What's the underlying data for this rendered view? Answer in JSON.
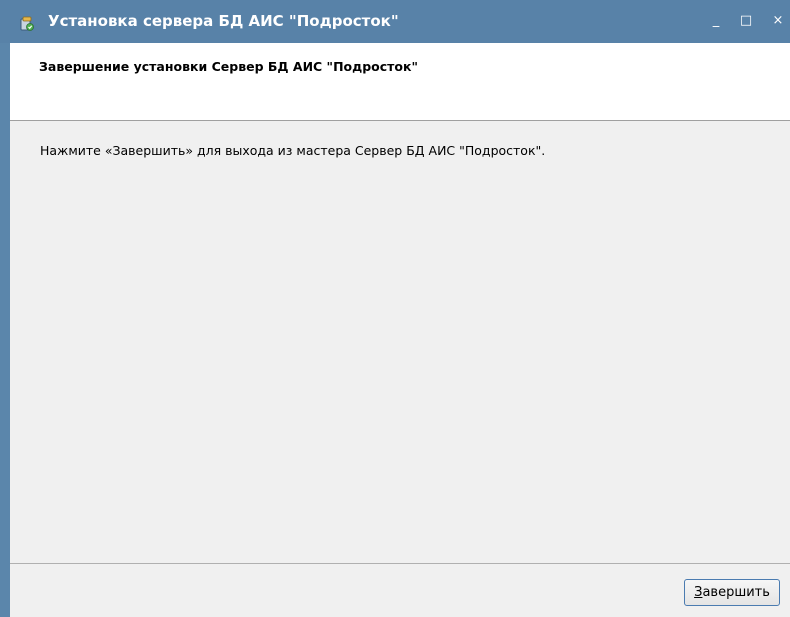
{
  "window": {
    "title": "Установка сервера БД АИС \"Подросток\"",
    "controls": {
      "minimize": "_",
      "maximize": "□",
      "close": "×"
    }
  },
  "header": {
    "title": "Завершение установки Сервер БД АИС \"Подросток\""
  },
  "body": {
    "message": "Нажмите «Завершить» для выхода из мастера Сервер БД АИС \"Подросток\"."
  },
  "footer": {
    "finish_label_mnemonic": "З",
    "finish_label_rest": "авершить"
  },
  "colors": {
    "titlebar": "#5882a8",
    "client_bg": "#f0f0f0",
    "header_bg": "#ffffff"
  }
}
